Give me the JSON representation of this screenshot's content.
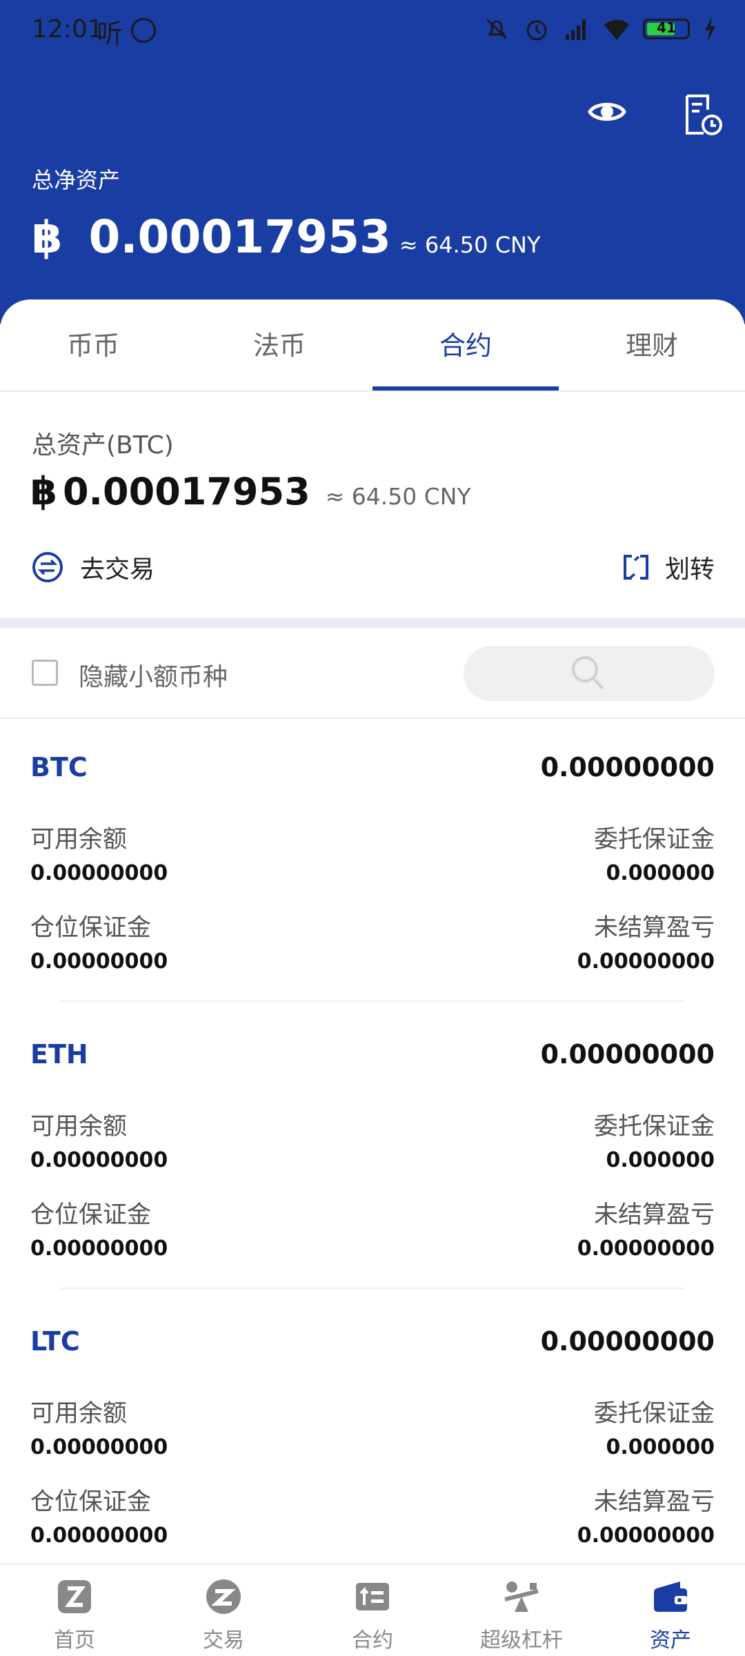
{
  "status_bar": {
    "time": "12:01",
    "ting_glyph": "听",
    "battery_level": "41",
    "icons": [
      "mute-icon",
      "alarm-icon",
      "signal-icon",
      "wifi-icon",
      "battery-icon",
      "charging-icon"
    ]
  },
  "header": {
    "net_assets_label": "总净资产",
    "btc_symbol": "฿",
    "net_assets_btc": "0.00017953",
    "net_assets_cny": "≈ 64.50 CNY"
  },
  "tabs": [
    {
      "label": "币币",
      "active": false
    },
    {
      "label": "法币",
      "active": false
    },
    {
      "label": "合约",
      "active": true
    },
    {
      "label": "理财",
      "active": false
    }
  ],
  "summary": {
    "total_label": "总资产(BTC)",
    "btc_symbol": "฿",
    "total_btc": "0.00017953",
    "total_cny": "≈ 64.50 CNY",
    "go_trade_label": "去交易",
    "transfer_label": "划转"
  },
  "filter": {
    "hide_small_label": "隐藏小额币种",
    "hide_small_checked": false,
    "search_value": ""
  },
  "coins": [
    {
      "name": "BTC",
      "total": "0.00000000",
      "available_label": "可用余额",
      "available": "0.00000000",
      "order_margin_label": "委托保证金",
      "order_margin": "0.000000",
      "position_margin_label": "仓位保证金",
      "position_margin": "0.00000000",
      "unrealized_label": "未结算盈亏",
      "unrealized": "0.00000000"
    },
    {
      "name": "ETH",
      "total": "0.00000000",
      "available_label": "可用余额",
      "available": "0.00000000",
      "order_margin_label": "委托保证金",
      "order_margin": "0.000000",
      "position_margin_label": "仓位保证金",
      "position_margin": "0.00000000",
      "unrealized_label": "未结算盈亏",
      "unrealized": "0.00000000"
    },
    {
      "name": "LTC",
      "total": "0.00000000",
      "available_label": "可用余额",
      "available": "0.00000000",
      "order_margin_label": "委托保证金",
      "order_margin": "0.000000",
      "position_margin_label": "仓位保证金",
      "position_margin": "0.00000000",
      "unrealized_label": "未结算盈亏",
      "unrealized": "0.00000000"
    }
  ],
  "bottom_nav": [
    {
      "label": "首页",
      "icon": "home-icon",
      "active": false
    },
    {
      "label": "交易",
      "icon": "trade-icon",
      "active": false
    },
    {
      "label": "合约",
      "icon": "contract-icon",
      "active": false
    },
    {
      "label": "超级杠杆",
      "icon": "leverage-icon",
      "active": false
    },
    {
      "label": "资产",
      "icon": "wallet-icon",
      "active": true
    }
  ],
  "colors": {
    "brand_blue": "#1a3da3",
    "divider": "#efefef",
    "band": "#e8ecf7"
  }
}
